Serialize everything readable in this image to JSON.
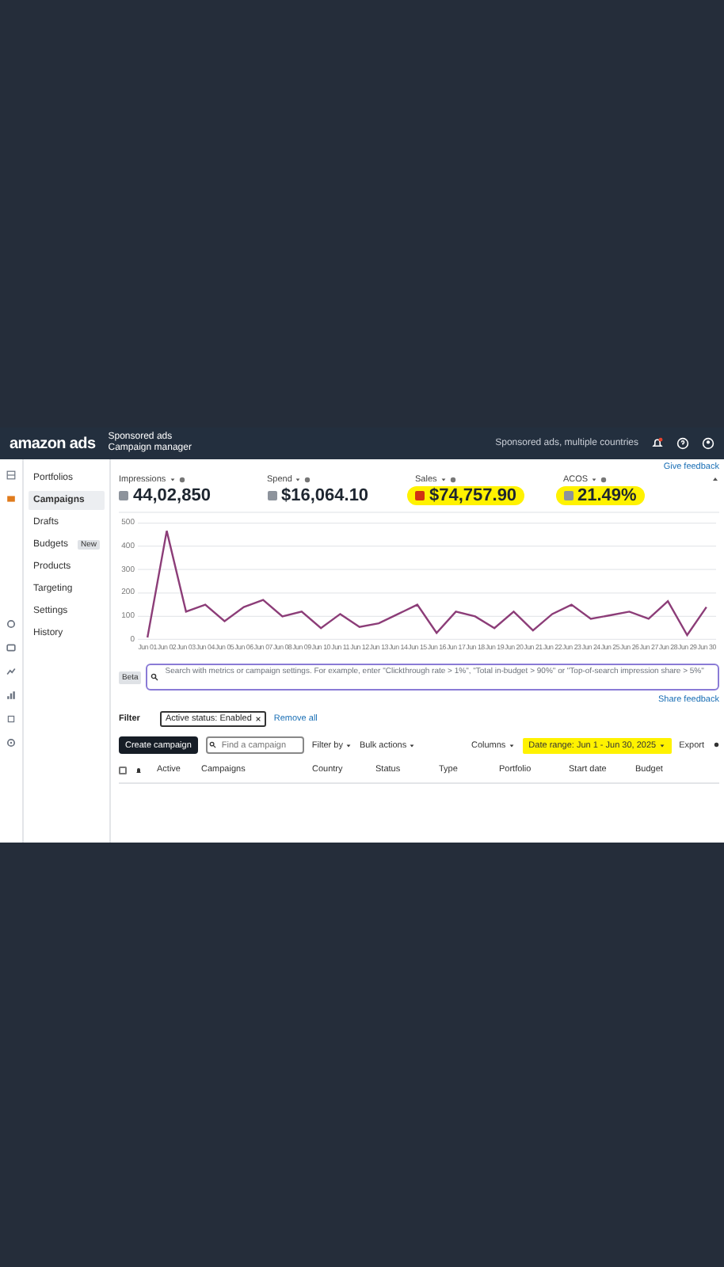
{
  "top_bar": {
    "logo": "amazon ads",
    "product": "Sponsored ads",
    "section": "Campaign manager",
    "account": "Sponsored ads, multiple countries"
  },
  "icon_rail": [
    {
      "selected": false
    },
    {
      "selected": true
    },
    {
      "selected": false
    },
    {
      "selected": false
    },
    {
      "selected": false
    },
    {
      "selected": false
    },
    {
      "selected": false
    },
    {
      "selected": false
    }
  ],
  "sidebar": {
    "items": [
      {
        "label": "Portfolios",
        "selected": false
      },
      {
        "label": "Campaigns",
        "selected": true
      },
      {
        "label": "Drafts",
        "selected": false
      },
      {
        "label": "Budgets",
        "selected": false,
        "badge": "New"
      },
      {
        "label": "Products",
        "selected": false
      },
      {
        "label": "Targeting",
        "selected": false
      },
      {
        "label": "Settings",
        "selected": false
      },
      {
        "label": "History",
        "selected": false
      }
    ]
  },
  "give_feedback": "Give feedback",
  "metrics": [
    {
      "label": "Impressions",
      "value": "44,02,850",
      "color": "#8d939c",
      "highlighted": false
    },
    {
      "label": "Spend",
      "value": "$16,064.10",
      "color": "#8d939c",
      "highlighted": false
    },
    {
      "label": "Sales",
      "value": "$74,757.90",
      "color": "#d13212",
      "highlighted": true
    },
    {
      "label": "ACOS",
      "value": "21.49%",
      "color": "#8d939c",
      "highlighted": true
    }
  ],
  "chart": {
    "chart_data": {
      "type": "line",
      "categories": [
        "Jun 01",
        "Jun 02",
        "Jun 03",
        "Jun 04",
        "Jun 05",
        "Jun 06",
        "Jun 07",
        "Jun 08",
        "Jun 09",
        "Jun 10",
        "Jun 11",
        "Jun 12",
        "Jun 13",
        "Jun 14",
        "Jun 15",
        "Jun 16",
        "Jun 17",
        "Jun 18",
        "Jun 19",
        "Jun 20",
        "Jun 21",
        "Jun 22",
        "Jun 23",
        "Jun 24",
        "Jun 25",
        "Jun 26",
        "Jun 27",
        "Jun 28",
        "Jun 29",
        "Jun 30"
      ],
      "series": [
        {
          "color": "#8c3d78",
          "values": [
            10,
            465,
            120,
            150,
            80,
            140,
            170,
            100,
            120,
            50,
            110,
            55,
            70,
            110,
            150,
            30,
            120,
            100,
            50,
            120,
            40,
            110,
            150,
            90,
            105,
            120,
            90,
            165,
            20,
            140
          ]
        }
      ],
      "ylim": [
        0,
        500
      ],
      "yticks": [
        0,
        100,
        200,
        300,
        400,
        500
      ],
      "grid": true
    }
  },
  "search": {
    "badge": "Beta",
    "placeholder": "Search with metrics or campaign settings. For example, enter \"Clickthrough rate > 1%\", \"Total in-budget > 90%\" or \"Top-of-search impression share > 5%\"",
    "feedback": "Share feedback"
  },
  "filter": {
    "label": "Filter",
    "chips": [
      {
        "text": "Active status: Enabled"
      }
    ],
    "remove_all": "Remove all"
  },
  "toolbar": {
    "create": "Create campaign",
    "find_placeholder": "Find a campaign",
    "filter_by": "Filter by",
    "bulk_actions": "Bulk actions",
    "columns": "Columns",
    "date_range": {
      "text": "Date range: Jun 1 - Jun 30, 2025",
      "highlighted": true
    },
    "export": "Export"
  },
  "table": {
    "select_all": {
      "checked": false
    },
    "columns": [
      "Active",
      "Campaigns",
      "Country",
      "Status",
      "Type",
      "Portfolio",
      "Start date",
      "Budget"
    ]
  }
}
